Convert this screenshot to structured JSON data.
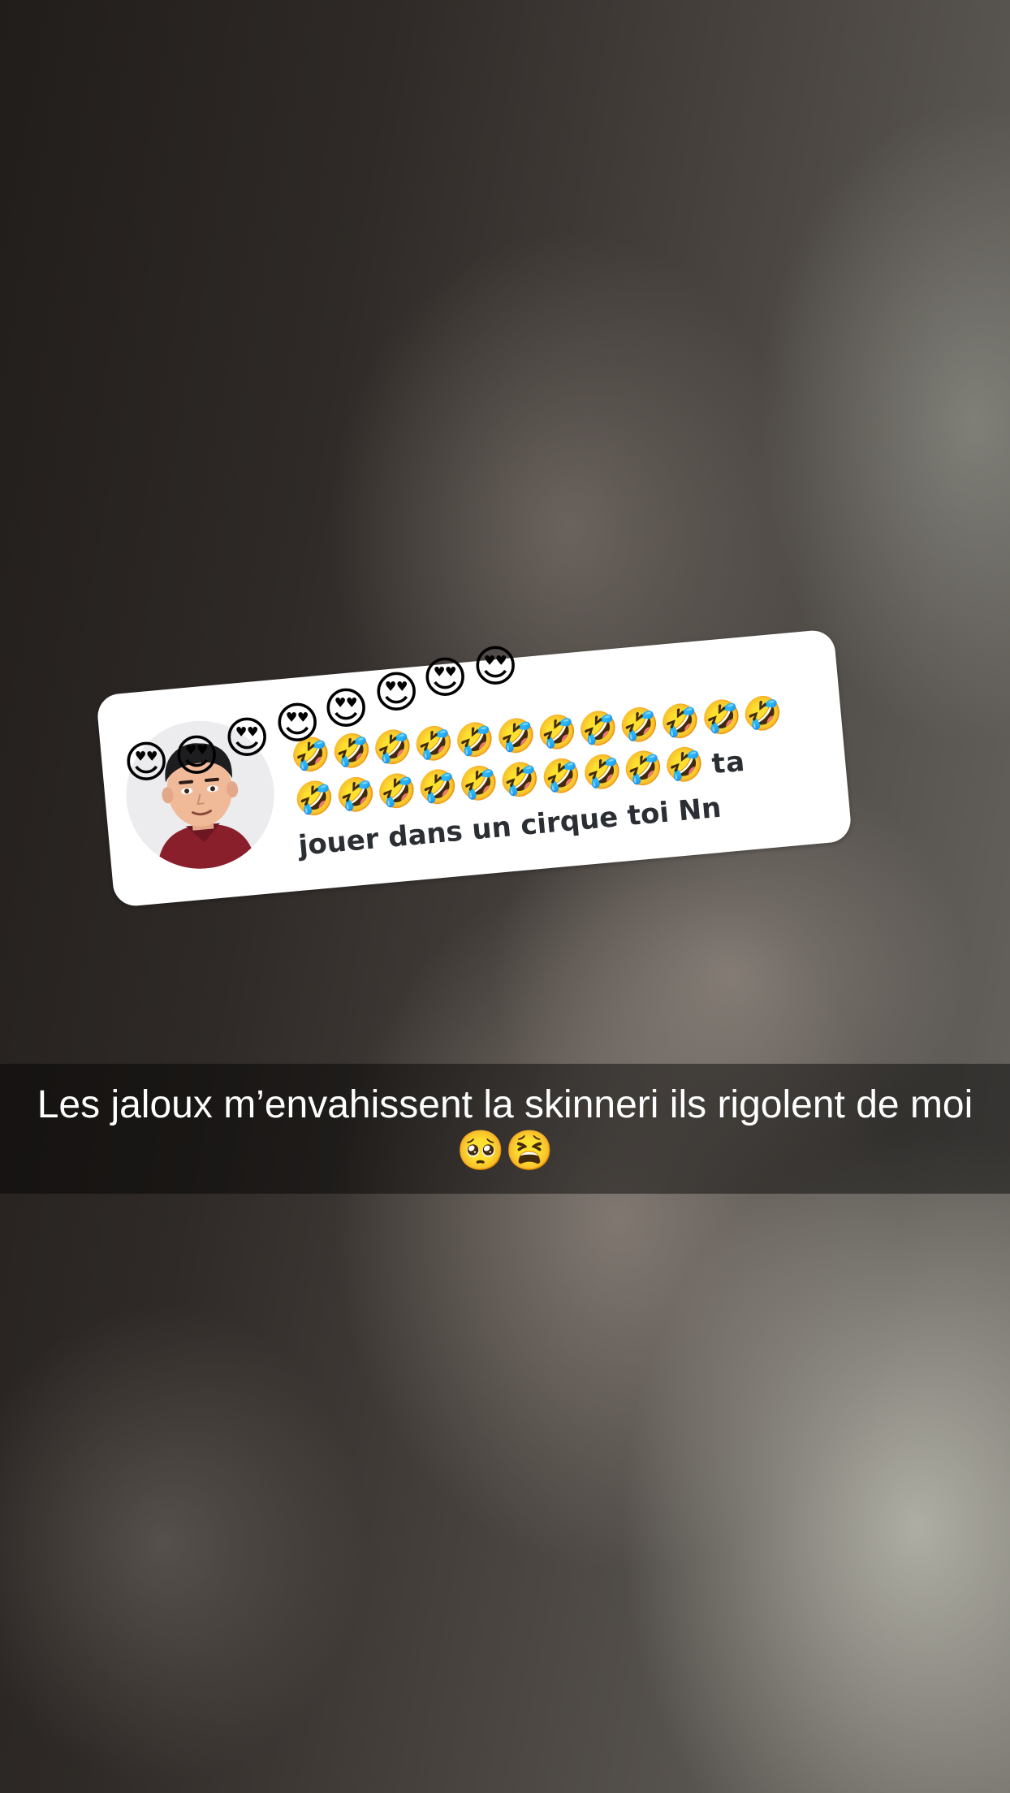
{
  "sticker": {
    "laugh_row_1": "🤣🤣🤣🤣🤣🤣🤣🤣🤣🤣🤣🤣",
    "laugh_row_2": "🤣🤣🤣🤣🤣🤣🤣🤣🤣🤣",
    "word_ta": "ta",
    "line_3": "jouer dans un cirque toi Nn",
    "heart_emoji": "😍"
  },
  "caption": {
    "text": "Les jaloux m’envahissent la skinneri ils rigolent de moi 🥺😫"
  },
  "icons": {
    "avatar": "bitmoji-avatar",
    "heart": "heart-eyes-emoji"
  }
}
